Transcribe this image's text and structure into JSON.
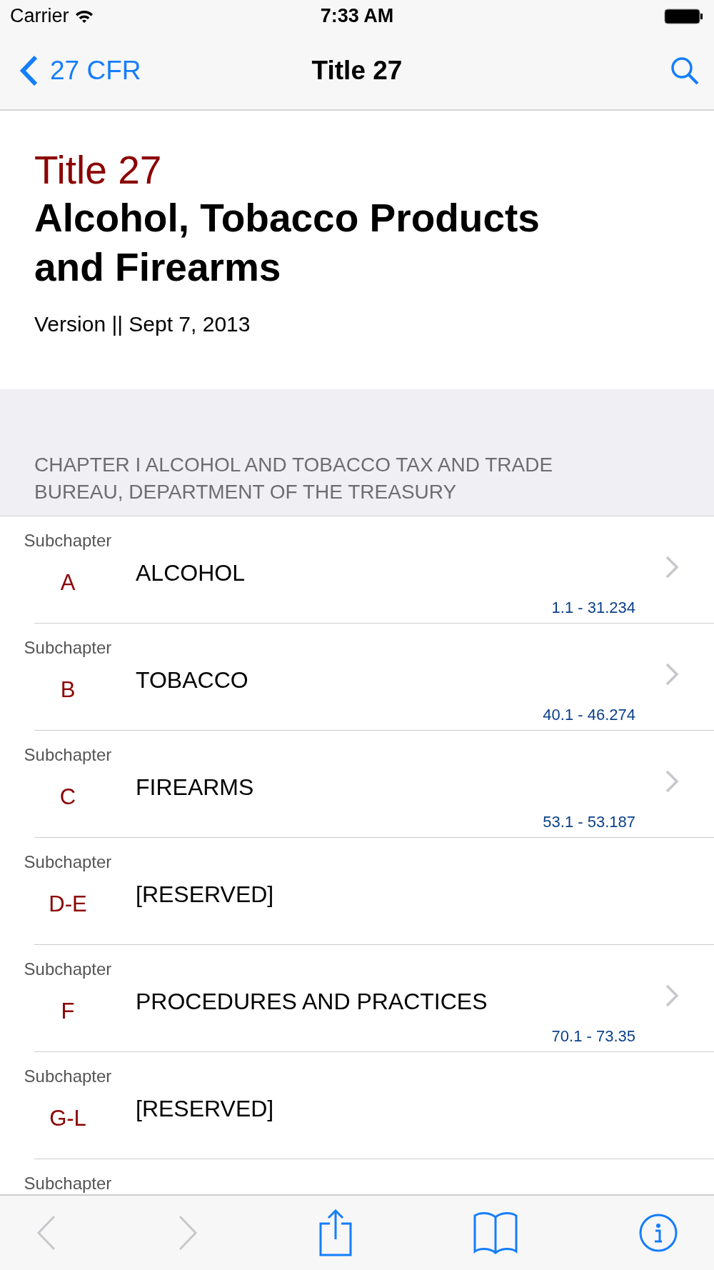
{
  "status_bar": {
    "carrier": "Carrier",
    "time": "7:33 AM"
  },
  "nav_bar": {
    "back": "27 CFR",
    "title": "Title 27"
  },
  "header": {
    "title_number": "Title 27",
    "title_name": "Alcohol, Tobacco Products and Firearms",
    "version": "Version || Sept 7, 2013"
  },
  "section": {
    "heading": "CHAPTER I ALCOHOL AND TOBACCO TAX AND TRADE BUREAU, DEPARTMENT OF THE TREASURY"
  },
  "rows": [
    {
      "label": "Subchapter",
      "letter": "A",
      "title": "ALCOHOL",
      "range": "1.1 - 31.234",
      "chevron": true
    },
    {
      "label": "Subchapter",
      "letter": "B",
      "title": "TOBACCO",
      "range": "40.1 - 46.274",
      "chevron": true
    },
    {
      "label": "Subchapter",
      "letter": "C",
      "title": "FIREARMS",
      "range": "53.1 - 53.187",
      "chevron": true
    },
    {
      "label": "Subchapter",
      "letter": "D-E",
      "title": "[RESERVED]",
      "chevron": false
    },
    {
      "label": "Subchapter",
      "letter": "F",
      "title": "PROCEDURES AND PRACTICES",
      "range": "70.1 - 73.35",
      "chevron": true
    },
    {
      "label": "Subchapter",
      "letter": "G-L",
      "title": "[RESERVED]",
      "chevron": false
    },
    {
      "label": "Subchapter",
      "chevron": false
    }
  ],
  "toolbar": [
    {
      "kind": "back",
      "disabled": true
    },
    {
      "kind": "forward",
      "disabled": true
    },
    {
      "kind": "share",
      "disabled": false
    },
    {
      "kind": "book",
      "disabled": false
    },
    {
      "kind": "info",
      "disabled": false
    }
  ]
}
